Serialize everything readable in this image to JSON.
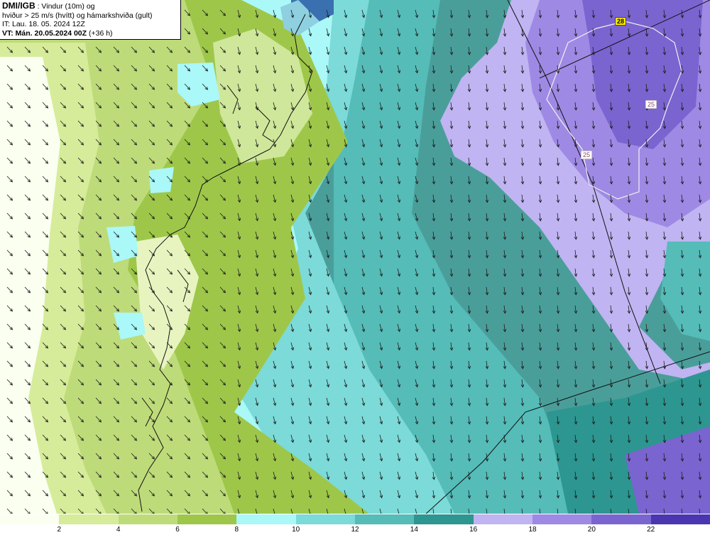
{
  "header": {
    "source": "DMI/IGB",
    "line1_rest": " : Vindur (10m) og",
    "line2": "hviður > 25 m/s (hvítt) og hámarkshviða (gult)",
    "line3": "IT: Lau. 18. 05. 2024 12Z",
    "valid_label": "VT: Mán. 20.05.2024 00Z",
    "lead": " (+36 h)"
  },
  "map_values": {
    "max_gust": "28",
    "gust_a": "25",
    "gust_b": "25"
  },
  "legend": {
    "unit_hint": "m/s",
    "ticks": [
      "2",
      "4",
      "6",
      "8",
      "10",
      "12",
      "14",
      "16",
      "18",
      "20",
      "22"
    ],
    "colors": [
      "#fafff0",
      "#d6ec9a",
      "#bedb7a",
      "#9ec74a",
      "#aaf8f8",
      "#7cdad8",
      "#55bcb8",
      "#2d9690",
      "#c0b4f2",
      "#9e8ae4",
      "#7a64d0",
      "#4a36b0"
    ]
  },
  "wind": {
    "direction": "north-north-west to south-south-east",
    "arrow_color": "#1c1c1c"
  }
}
